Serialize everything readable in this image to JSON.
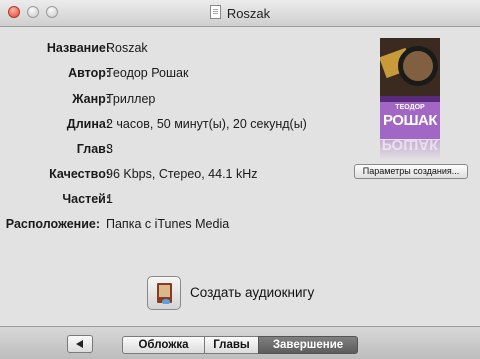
{
  "window": {
    "title": "Roszak"
  },
  "info": [
    {
      "label": "Название:",
      "value": "Roszak"
    },
    {
      "label": "Автор:",
      "value": "Теодор Рошак"
    },
    {
      "label": "Жанр:",
      "value": "Триллер"
    },
    {
      "label": "Длина:",
      "value": "2 часов, 50 минут(ы), 20 секунд(ы)"
    },
    {
      "label": "Глав:",
      "value": "3"
    },
    {
      "label": "Качество:",
      "value": "96 Kbps, Стерео, 44.1 kHz"
    },
    {
      "label": "Частей:",
      "value": "1"
    },
    {
      "label": "Расположение:",
      "value": "Папка с iTunes Media"
    }
  ],
  "cover": {
    "author": "ТЕОДОР",
    "title": "РОШАК",
    "accent": "#a267c5"
  },
  "buttons": {
    "params": "Параметры создания...",
    "create": "Создать аудиокнигу"
  },
  "icons": {
    "back": "arrow-left-icon",
    "create": "audiobook-icon"
  },
  "tabs": [
    {
      "label": "Обложка",
      "selected": false
    },
    {
      "label": "Главы",
      "selected": false
    },
    {
      "label": "Завершение",
      "selected": true
    }
  ]
}
